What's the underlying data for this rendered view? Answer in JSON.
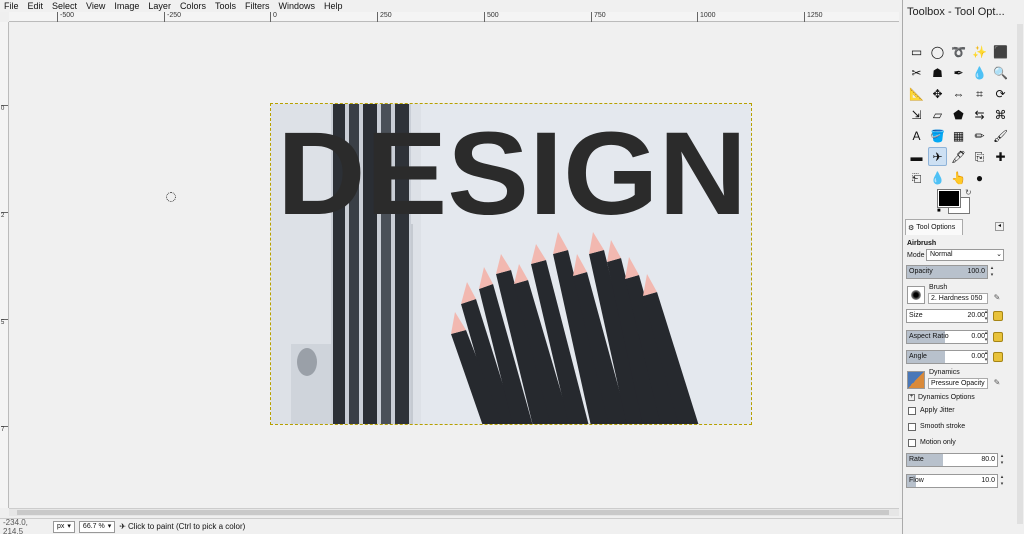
{
  "menubar": {
    "items": [
      "File",
      "Edit",
      "Select",
      "View",
      "Image",
      "Layer",
      "Colors",
      "Tools",
      "Filters",
      "Windows",
      "Help"
    ]
  },
  "ruler": {
    "h_labels": [
      "-500",
      "-250",
      "0",
      "250",
      "500",
      "750",
      "1000",
      "1250"
    ],
    "v_labels": [
      "0",
      "2",
      "5",
      "7"
    ]
  },
  "image": {
    "headline": "DESIGN"
  },
  "statusbar": {
    "coords": "-234.0, 214.5",
    "unit": "px",
    "zoom": "66.7 %",
    "message": "Click to paint (Ctrl to pick a color)"
  },
  "dock": {
    "title": "Toolbox - Tool Opt...",
    "tools": [
      "rect-select-icon",
      "ellipse-select-icon",
      "lasso-icon",
      "fuzzy-select-icon",
      "by-color-select-icon",
      "scissors-select-icon",
      "foreground-select-icon",
      "paths-icon",
      "color-picker-icon",
      "zoom-icon",
      "measure-icon",
      "move-icon",
      "align-icon",
      "crop-icon",
      "rotate-icon",
      "scale-icon",
      "shear-icon",
      "perspective-icon",
      "flip-icon",
      "cage-icon",
      "text-icon",
      "bucket-fill-icon",
      "gradient-icon",
      "pencil-icon",
      "paintbrush-icon",
      "eraser-icon",
      "airbrush-icon",
      "ink-icon",
      "clone-icon",
      "heal-icon",
      "perspective-clone-icon",
      "blur-icon",
      "smudge-icon",
      "dodge-burn-icon"
    ],
    "tool_glyphs": [
      "▭",
      "◯",
      "➰",
      "✨",
      "⬛",
      "✂",
      "☗",
      "✒",
      "💧",
      "🔍",
      "📐",
      "✥",
      "⇔",
      "⌗",
      "⟳",
      "⇲",
      "▱",
      "⬟",
      "⇆",
      "⌘",
      "A",
      "🪣",
      "▦",
      "✏",
      "🖌",
      "▬",
      "✈",
      "🖋",
      "⎘",
      "✚",
      "⎗",
      "💧",
      "👆",
      "●"
    ],
    "active_tool_index": 26
  },
  "tool_options": {
    "tab_label": "Tool Options",
    "tool_name": "Airbrush",
    "mode_label": "Mode",
    "mode_value": "Normal",
    "opacity_label": "Opacity",
    "opacity_value": "100.0",
    "brush_label": "Brush",
    "brush_value": "2. Hardness 050",
    "size_label": "Size",
    "size_value": "20.00",
    "aspect_label": "Aspect Ratio",
    "aspect_value": "0.00",
    "angle_label": "Angle",
    "angle_value": "0.00",
    "dynamics_label": "Dynamics",
    "dynamics_value": "Pressure Opacity",
    "dynamics_options_label": "Dynamics Options",
    "apply_jitter_label": "Apply Jitter",
    "smooth_stroke_label": "Smooth stroke",
    "motion_only_label": "Motion only",
    "rate_label": "Rate",
    "rate_value": "80.0",
    "rate_fraction": 0.4,
    "flow_label": "Flow",
    "flow_value": "10.0",
    "flow_fraction": 0.1
  },
  "colors": {
    "foreground": "#000000",
    "background": "#ffffff",
    "accent": "#b8c1cc"
  }
}
